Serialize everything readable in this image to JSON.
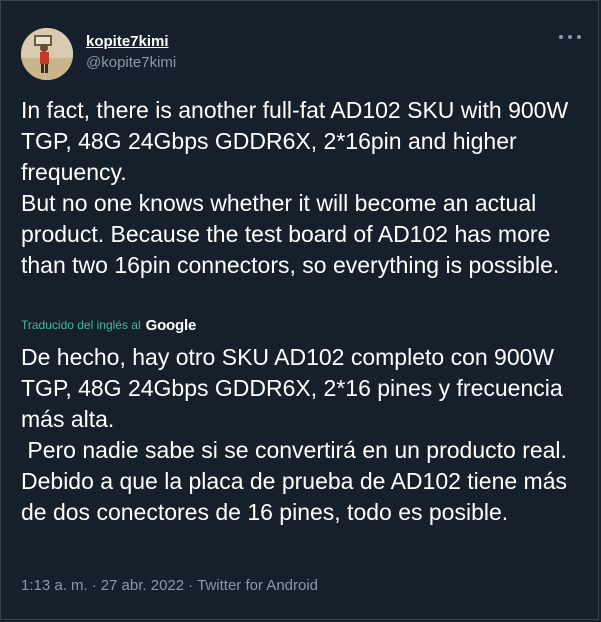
{
  "tweet": {
    "display_name": "kopite7kimi",
    "handle": "@kopite7kimi",
    "more_icon": "more-horizontal-icon",
    "original_paragraphs": [
      "In fact, there is another full-fat AD102 SKU with 900W TGP, 48G 24Gbps GDDR6X, 2*16pin and higher frequency.",
      "But no one knows whether it will become an actual product. Because the test board of AD102 has more than two 16pin connectors, so everything is possible."
    ],
    "translation": {
      "label": "Traducido del inglés al",
      "provider": "Google",
      "paragraphs": [
        "De hecho, hay otro SKU AD102 completo con 900W TGP, 48G 24Gbps GDDR6X, 2*16 pines y frecuencia más alta.",
        " Pero nadie sabe si se convertirá en un producto real. Debido a que la placa de prueba de AD102 tiene más de dos conectores de 16 pines, todo es posible."
      ]
    },
    "time": "1:13 a. m.",
    "separator": "·",
    "date": "27 abr. 2022",
    "source": "Twitter for Android"
  },
  "colors": {
    "background": "#15202b",
    "border": "#38444d",
    "text": "#ffffff",
    "secondary_text": "#8b98a5",
    "translation_label": "#45b89a"
  }
}
